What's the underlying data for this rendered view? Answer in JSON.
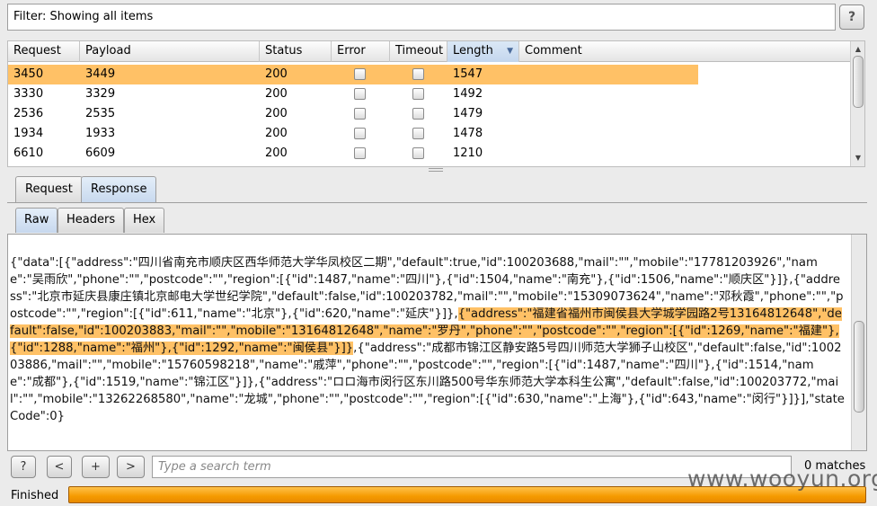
{
  "filter": {
    "text": "Filter: Showing all items",
    "help_label": "?"
  },
  "table": {
    "columns": [
      "Request",
      "Payload",
      "Status",
      "Error",
      "Timeout",
      "Length",
      "Comment"
    ],
    "sorted_column": "Length",
    "rows": [
      {
        "request": "3450",
        "payload": "3449",
        "status": "200",
        "error": false,
        "timeout": false,
        "length": "1547",
        "comment": "",
        "selected": true
      },
      {
        "request": "3330",
        "payload": "3329",
        "status": "200",
        "error": false,
        "timeout": false,
        "length": "1492",
        "comment": "",
        "selected": false
      },
      {
        "request": "2536",
        "payload": "2535",
        "status": "200",
        "error": false,
        "timeout": false,
        "length": "1479",
        "comment": "",
        "selected": false
      },
      {
        "request": "1934",
        "payload": "1933",
        "status": "200",
        "error": false,
        "timeout": false,
        "length": "1478",
        "comment": "",
        "selected": false
      },
      {
        "request": "6610",
        "payload": "6609",
        "status": "200",
        "error": false,
        "timeout": false,
        "length": "1210",
        "comment": "",
        "selected": false
      }
    ]
  },
  "tabs": {
    "main": [
      "Request",
      "Response"
    ],
    "active_main": "Response",
    "sub": [
      "Raw",
      "Headers",
      "Hex"
    ],
    "active_sub": "Raw"
  },
  "response": {
    "before": "{\"data\":[{\"address\":\"四川省南充市顺庆区西华师范大学华凤校区二期\",\"default\":true,\"id\":100203688,\"mail\":\"\",\"mobile\":\"17781203926\",\"name\":\"吴雨欣\",\"phone\":\"\",\"postcode\":\"\",\"region\":[{\"id\":1487,\"name\":\"四川\"},{\"id\":1504,\"name\":\"南充\"},{\"id\":1506,\"name\":\"顺庆区\"}]},{\"address\":\"北京市延庆县康庄镇北京邮电大学世纪学院\",\"default\":false,\"id\":100203782,\"mail\":\"\",\"mobile\":\"15309073624\",\"name\":\"邓秋霞\",\"phone\":\"\",\"postcode\":\"\",\"region\":[{\"id\":611,\"name\":\"北京\"},{\"id\":620,\"name\":\"延庆\"}]},",
    "highlight": "{\"address\":\"福建省福州市闽侯县大学城学园路2号13164812648\",\"default\":false,\"id\":100203883,\"mail\":\"\",\"mobile\":\"13164812648\",\"name\":\"罗丹\",\"phone\":\"\",\"postcode\":\"\",\"region\":[{\"id\":1269,\"name\":\"福建\"},{\"id\":1288,\"name\":\"福州\"},{\"id\":1292,\"name\":\"闽侯县\"}]}",
    "after": ",{\"address\":\"成都市锦江区静安路5号四川师范大学狮子山校区\",\"default\":false,\"id\":100203886,\"mail\":\"\",\"mobile\":\"15760598218\",\"name\":\"戚萍\",\"phone\":\"\",\"postcode\":\"\",\"region\":[{\"id\":1487,\"name\":\"四川\"},{\"id\":1514,\"name\":\"成都\"},{\"id\":1519,\"name\":\"锦江区\"}]},{\"address\":\"ロロ海市闵行区东川路500号华东师范大学本科生公寓\",\"default\":false,\"id\":100203772,\"mail\":\"\",\"mobile\":\"13262268580\",\"name\":\"龙城\",\"phone\":\"\",\"postcode\":\"\",\"region\":[{\"id\":630,\"name\":\"上海\"},{\"id\":643,\"name\":\"闵行\"}]}],\"stateCode\":0}"
  },
  "search": {
    "help_label": "?",
    "prev_label": "<",
    "add_label": "+",
    "next_label": ">",
    "placeholder": "Type a search term",
    "matches": "0 matches"
  },
  "status": {
    "text": "Finished",
    "progress": 1.0
  },
  "watermark": "www.wooyun.org",
  "colors": {
    "selection": "#ffc166",
    "progress": "#f59a00"
  }
}
